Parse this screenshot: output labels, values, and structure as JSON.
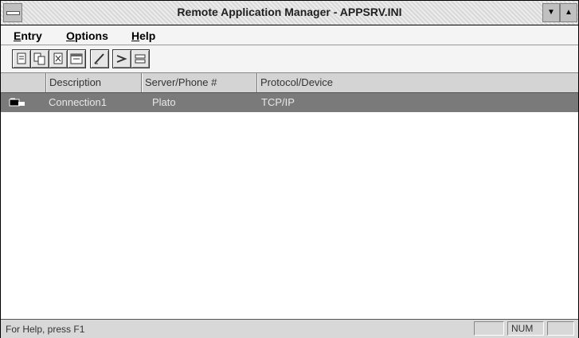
{
  "window": {
    "title": "Remote Application Manager - APPSRV.INI"
  },
  "titlebar": {
    "min_glyph": "▼",
    "max_glyph": "▲"
  },
  "menu": [
    "Entry",
    "Options",
    "Help"
  ],
  "toolbar": {
    "buttons": [
      {
        "icon": "new-entry-icon"
      },
      {
        "icon": "copy-entry-icon"
      },
      {
        "icon": "delete-entry-icon"
      },
      {
        "icon": "properties-icon"
      },
      {
        "icon": "edit-icon"
      },
      {
        "icon": "connect-icon"
      },
      {
        "icon": "disconnect-icon"
      }
    ]
  },
  "columns": [
    "Description",
    "Server/Phone #",
    "Protocol/Device"
  ],
  "rows": [
    {
      "description": "Connection1",
      "server": "Plato",
      "protocol": "TCP/IP",
      "selected": true
    }
  ],
  "status": {
    "help": "For Help, press F1",
    "num": "NUM"
  }
}
